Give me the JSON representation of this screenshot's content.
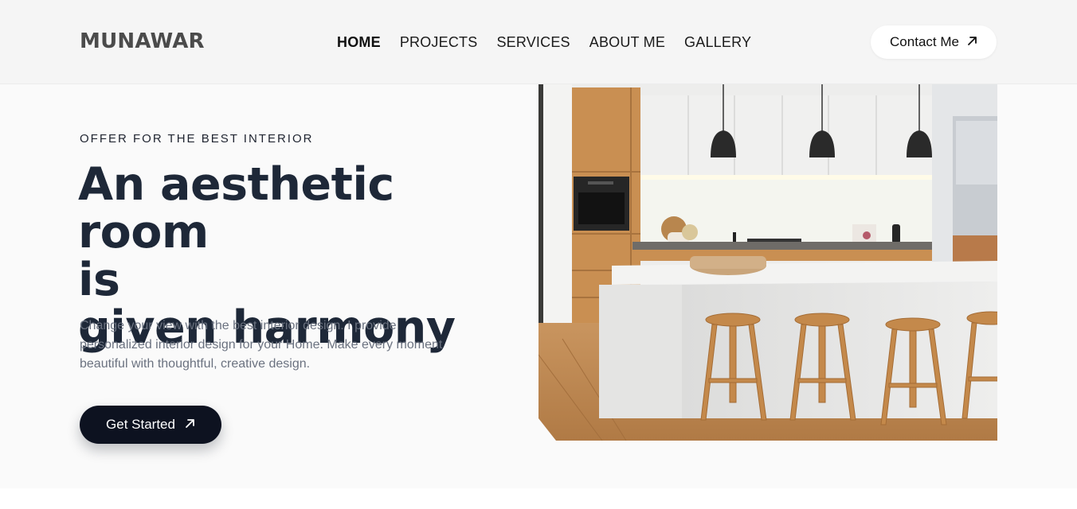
{
  "brand": {
    "logo": "MUNAWAR"
  },
  "nav": {
    "items": [
      {
        "label": "HOME",
        "active": true
      },
      {
        "label": "PROJECTS"
      },
      {
        "label": "SERVICES"
      },
      {
        "label": "ABOUT ME"
      },
      {
        "label": "GALLERY"
      }
    ],
    "contact_label": "Contact Me",
    "contact_icon": "arrow-up-right-icon"
  },
  "hero": {
    "eyebrow": "OFFER FOR THE BEST INTERIOR",
    "headline_lines": [
      "An aesthetic room",
      "is",
      "given harmony"
    ],
    "description": "Change your view with the best interior design. I provide personalized interior design for your Home. Make every moment beautiful with thoughtful, creative design.",
    "cta_label": "Get Started",
    "cta_icon": "arrow-up-right-icon",
    "image": "kitchen-interior-photo"
  },
  "colors": {
    "header_bg": "#f5f5f5",
    "hero_bg": "#fafafa",
    "headline": "#1e2838",
    "body_text": "#6b7280",
    "cta_bg": "#0d1220",
    "cta_text": "#ffffff"
  }
}
